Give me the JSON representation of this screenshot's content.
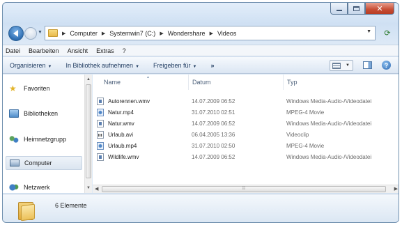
{
  "window": {
    "caption_buttons": [
      "minimize",
      "maximize",
      "close"
    ]
  },
  "address": {
    "crumbs": [
      "Computer",
      "Systemwin7 (C:)",
      "Wondershare",
      "Videos"
    ]
  },
  "menu": [
    "Datei",
    "Bearbeiten",
    "Ansicht",
    "Extras",
    "?"
  ],
  "commands": {
    "organize": "Organisieren",
    "library": "In Bibliothek aufnehmen",
    "share": "Freigeben für",
    "more": "»"
  },
  "nav": {
    "favorites": "Favoriten",
    "libraries": "Bibliotheken",
    "homegroup": "Heimnetzgrupp",
    "computer": "Computer",
    "network": "Netzwerk"
  },
  "columns": {
    "name": "Name",
    "date": "Datum",
    "type": "Typ"
  },
  "files": [
    {
      "name": "Autorennen.wmv",
      "date": "14.07.2009 06:52",
      "type": "Windows Media-Audio-/Videodatei",
      "icon": "wmv-file-icon"
    },
    {
      "name": "Natur.mp4",
      "date": "31.07.2010 02:51",
      "type": "MPEG-4 Movie",
      "icon": "mp4-file-icon"
    },
    {
      "name": "Natur.wmv",
      "date": "14.07.2009 06:52",
      "type": "Windows Media-Audio-/Videodatei",
      "icon": "wmv-file-icon"
    },
    {
      "name": "Urlaub.avi",
      "date": "06.04.2005 13:36",
      "type": "Videoclip",
      "icon": "avi-file-icon"
    },
    {
      "name": "Urlaub.mp4",
      "date": "31.07.2010 02:50",
      "type": "MPEG-4 Movie",
      "icon": "mp4-file-icon"
    },
    {
      "name": "Wildlife.wmv",
      "date": "14.07.2009 06:52",
      "type": "Windows Media-Audio-/Videodatei",
      "icon": "wmv-file-icon"
    }
  ],
  "status": {
    "count_text": "6 Elemente"
  },
  "colors": {
    "accent": "#2f6fb3",
    "window_frame": "#cfe0f3",
    "close_button": "#c74d34",
    "folder": "#e8b94a"
  }
}
